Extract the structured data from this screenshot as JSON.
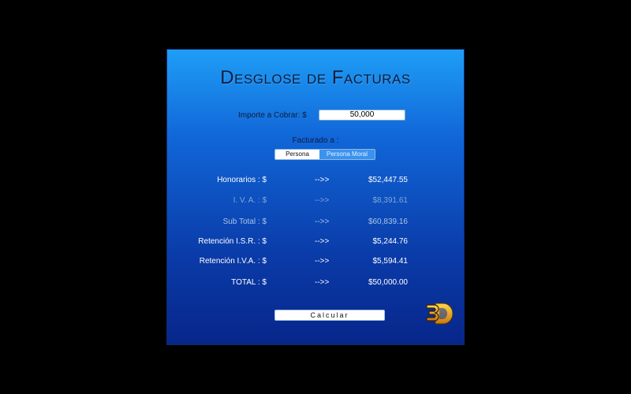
{
  "title": "Desglose de Facturas",
  "importe": {
    "label": "Importe a Cobrar: $",
    "value": "50,000"
  },
  "facturado": {
    "label": "Facturado a :",
    "options": [
      "Persona Física",
      "Persona Moral"
    ],
    "selected": "Persona Moral"
  },
  "rows": [
    {
      "label": "Honorarios : $",
      "arrow": "-->>",
      "value": "$52,447.55",
      "style": "white"
    },
    {
      "label": "I. V. A. : $",
      "arrow": "-->>",
      "value": "$8,391.61",
      "style": "dim"
    },
    {
      "label": "Sub Total : $",
      "arrow": "-->>",
      "value": "$60,839.16",
      "style": "mid"
    },
    {
      "label": "Retención I.S.R. : $",
      "arrow": "-->>",
      "value": "$5,244.76",
      "style": "white"
    },
    {
      "label": "Retención I.V.A. : $",
      "arrow": "-->>",
      "value": "$5,594.41",
      "style": "white"
    },
    {
      "label": "TOTAL : $",
      "arrow": "-->>",
      "value": "$50,000.00",
      "style": "white"
    }
  ],
  "button": {
    "label": "Calcular"
  },
  "logo": {
    "text": "3D",
    "icon": "3d-logo-icon"
  },
  "colors": {
    "accent": "#3b93ee",
    "window_top": "#1e9ef6",
    "window_bottom": "#07268a"
  }
}
